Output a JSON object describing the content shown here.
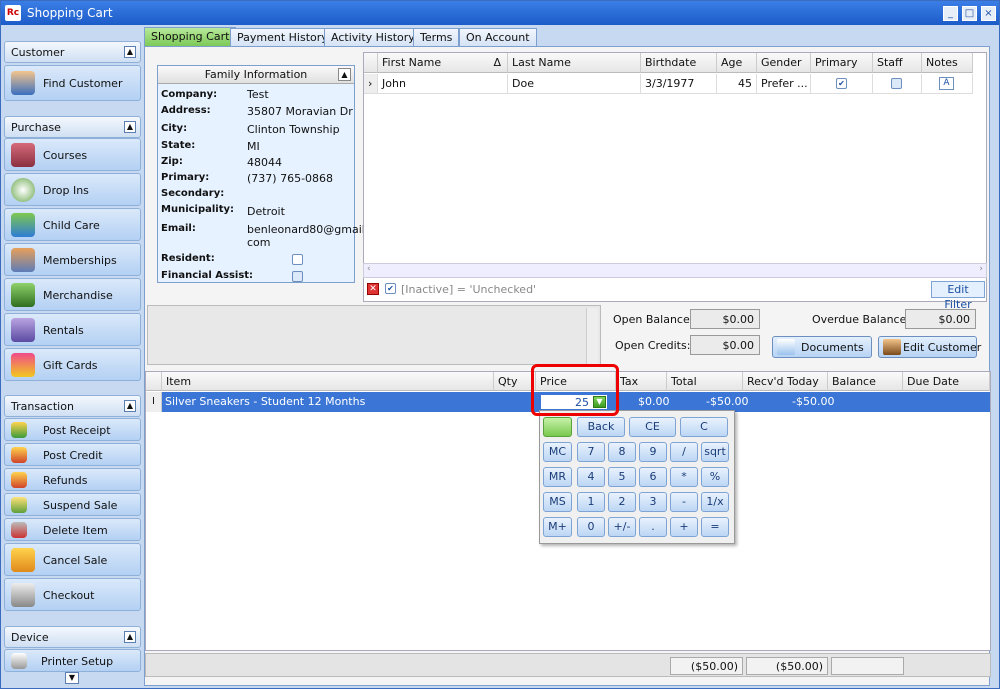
{
  "window": {
    "title": "Shopping Cart",
    "icon_text": "Rc"
  },
  "sidebar": {
    "customer": {
      "header": "Customer",
      "items": [
        {
          "label": "Find Customer"
        }
      ]
    },
    "purchase": {
      "header": "Purchase",
      "items": [
        {
          "label": "Courses"
        },
        {
          "label": "Drop Ins"
        },
        {
          "label": "Child Care"
        },
        {
          "label": "Memberships"
        },
        {
          "label": "Merchandise"
        },
        {
          "label": "Rentals"
        },
        {
          "label": "Gift Cards"
        }
      ]
    },
    "transaction": {
      "header": "Transaction",
      "items": [
        {
          "label": "Post Receipt"
        },
        {
          "label": "Post Credit"
        },
        {
          "label": "Refunds"
        },
        {
          "label": "Suspend Sale"
        },
        {
          "label": "Delete Item"
        },
        {
          "label": "Cancel Sale"
        },
        {
          "label": "Checkout"
        }
      ]
    },
    "device": {
      "header": "Device",
      "items": [
        {
          "label": "Printer Setup"
        }
      ]
    }
  },
  "tabs": [
    {
      "label": "Shopping Cart"
    },
    {
      "label": "Payment History"
    },
    {
      "label": "Activity History"
    },
    {
      "label": "Terms"
    },
    {
      "label": "On Account"
    }
  ],
  "family": {
    "header": "Family Information",
    "fields": [
      {
        "label": "Company:",
        "value": "Test"
      },
      {
        "label": "Address:",
        "value": "35807 Moravian Dr"
      },
      {
        "label": "City:",
        "value": "Clinton Township"
      },
      {
        "label": "State:",
        "value": "MI"
      },
      {
        "label": "Zip:",
        "value": "48044"
      },
      {
        "label": "Primary:",
        "value": "(737) 765-0868"
      },
      {
        "label": "Secondary:",
        "value": ""
      },
      {
        "label": "Municipality:",
        "value": "Detroit"
      },
      {
        "label": "Email:",
        "value": "benleonard80@gmail.",
        "value2": "com"
      }
    ],
    "resident_label": "Resident:",
    "financial_label": "Financial Assist:"
  },
  "members": {
    "columns": [
      "First Name",
      "Last Name",
      "Birthdate",
      "Age",
      "Gender",
      "Primary",
      "Staff",
      "Notes"
    ],
    "sort_indicator": "Δ",
    "row": {
      "first": "John",
      "last": "Doe",
      "birthdate": "3/3/1977",
      "age": "45",
      "gender": "Prefer ...",
      "primary": true,
      "staff": false
    },
    "filter_text": "[Inactive] = 'Unchecked'",
    "edit_filter": "Edit Filter"
  },
  "balances": {
    "open_balance_label": "Open Balance:",
    "open_balance": "$0.00",
    "overdue_label": "Overdue Balance:",
    "overdue": "$0.00",
    "open_credits_label": "Open Credits:",
    "open_credits": "$0.00",
    "documents": "Documents",
    "edit_customer": "Edit Customer"
  },
  "cart": {
    "columns": [
      "Item",
      "Qty",
      "Price",
      "Tax",
      "Total",
      "Recv'd Today",
      "Balance",
      "Due Date"
    ],
    "row": {
      "item": "Silver Sneakers - Student 12 Months",
      "qty": "",
      "price": "25",
      "tax": "$0.00",
      "total": "-$50.00",
      "received": "-$50.00",
      "balance": "",
      "due": ""
    },
    "row_marker": "I",
    "footer": {
      "total": "($50.00)",
      "received": "($50.00)",
      "balance": ""
    }
  },
  "calculator": {
    "rows": [
      [
        "",
        "Back",
        "CE",
        "C"
      ],
      [
        "MC",
        "7",
        "8",
        "9",
        "/",
        "sqrt"
      ],
      [
        "MR",
        "4",
        "5",
        "6",
        "*",
        "%"
      ],
      [
        "MS",
        "1",
        "2",
        "3",
        "-",
        "1/x"
      ],
      [
        "M+",
        "0",
        "+/-",
        ".",
        "+",
        "="
      ]
    ]
  },
  "colors": {
    "accent": "#3b76d6",
    "tab_active": "#7cc957",
    "highlight": "#e00000"
  }
}
